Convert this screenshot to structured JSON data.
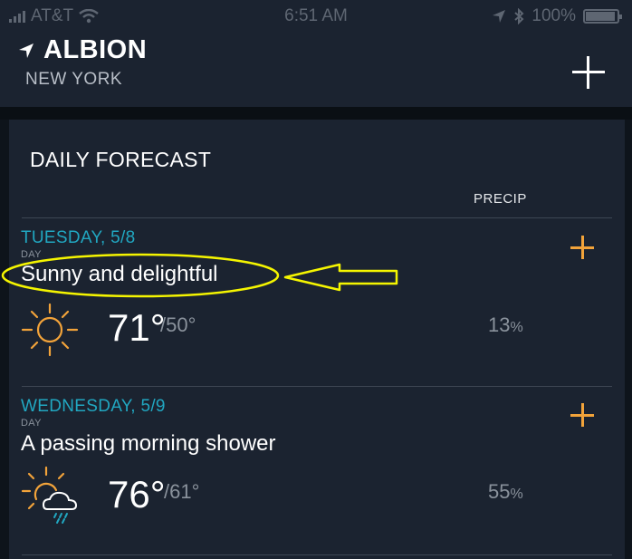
{
  "status_bar": {
    "carrier": "AT&T",
    "time": "6:51 AM",
    "battery_percent": "100%",
    "battery_level": 1.0
  },
  "location": {
    "city": "ALBION",
    "state": "NEW YORK"
  },
  "forecast": {
    "title": "DAILY FORECAST",
    "precip_header": "PRECIP",
    "days": [
      {
        "name": "TUESDAY, 5/8",
        "period": "DAY",
        "summary": "Sunny and delightful",
        "high": "71°",
        "low": "/50°",
        "precip_value": "13",
        "precip_unit": "%",
        "icon": "sun-icon"
      },
      {
        "name": "WEDNESDAY, 5/9",
        "period": "DAY",
        "summary": "A passing morning shower",
        "high": "76°",
        "low": "/61°",
        "precip_value": "55",
        "precip_unit": "%",
        "icon": "sun-cloud-rain-icon"
      }
    ]
  },
  "colors": {
    "accent_blue": "#21a7c1",
    "accent_orange": "#f2a33a",
    "annotation_yellow": "#f5f500"
  }
}
